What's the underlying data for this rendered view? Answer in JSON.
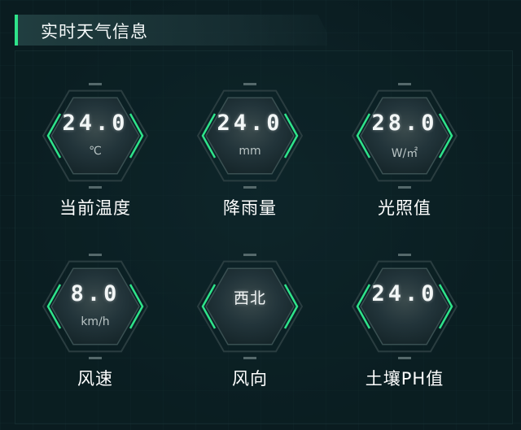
{
  "header": {
    "title": "实时天气信息"
  },
  "colors": {
    "accent": "#2fe38a",
    "background": "#0a1c20",
    "hex_fill": "#1b2e31"
  },
  "metrics": [
    {
      "value": "24.0",
      "unit": "℃",
      "label": "当前温度"
    },
    {
      "value": "24.0",
      "unit": "mm",
      "label": "降雨量"
    },
    {
      "value": "28.0",
      "unit": "W/㎡",
      "label": "光照值"
    },
    {
      "value": "8.0",
      "unit": "km/h",
      "label": "风速"
    },
    {
      "value": "西北",
      "unit": "",
      "label": "风向"
    },
    {
      "value": "24.0",
      "unit": "",
      "label": "土壤PH值"
    }
  ]
}
